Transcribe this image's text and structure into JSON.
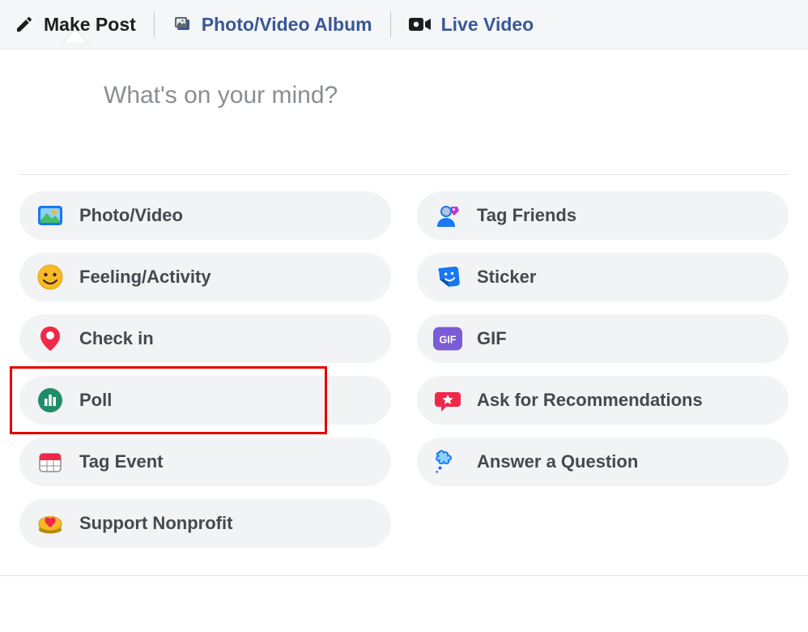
{
  "tabs": {
    "make_post": "Make Post",
    "photo_video_album": "Photo/Video Album",
    "live_video": "Live Video"
  },
  "composer": {
    "placeholder": "What's on your mind?"
  },
  "options": {
    "photo_video": "Photo/Video",
    "tag_friends": "Tag Friends",
    "feeling_activity": "Feeling/Activity",
    "sticker": "Sticker",
    "check_in": "Check in",
    "gif": "GIF",
    "poll": "Poll",
    "recommendations": "Ask for Recommendations",
    "tag_event": "Tag Event",
    "answer_question": "Answer a Question",
    "support_nonprofit": "Support Nonprofit"
  },
  "icon_text": {
    "gif": "GIF"
  },
  "annotations": {
    "highlighted_option": "poll"
  }
}
